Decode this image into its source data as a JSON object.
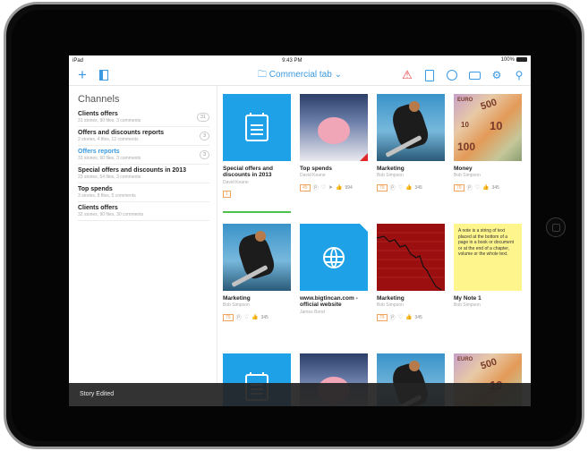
{
  "status": {
    "device": "iPad",
    "time": "9:43 PM",
    "battery": "100%"
  },
  "toolbar": {
    "title": "Commercial tab"
  },
  "channels": {
    "title": "Channels",
    "items": [
      {
        "name": "Clients offers",
        "meta": "31 stories, 90 files, 3 comments",
        "badge": "31",
        "active": false
      },
      {
        "name": "Offers and discounts reports",
        "meta": "2 stories, 4 files, 12 comments",
        "badge": "3",
        "active": false
      },
      {
        "name": "Offers reports",
        "meta": "31 stories, 90 files, 3 comments",
        "badge": "3",
        "active": true
      },
      {
        "name": "Special offers and discounts in 2013",
        "meta": "23 stories, 54 files, 3 comments",
        "badge": "",
        "active": false
      },
      {
        "name": "Top spends",
        "meta": "3 stories, 8 files, 5 comments",
        "badge": "",
        "active": false
      },
      {
        "name": "Clients offers",
        "meta": "32 stories, 90 files, 30 comments",
        "badge": "",
        "active": false
      }
    ]
  },
  "tiles": [
    {
      "title": "Special offers and discounts in 2013",
      "author": "David Keane",
      "count": "1",
      "likes": ""
    },
    {
      "title": "Top spends",
      "author": "David Keane",
      "count": "45",
      "likes": "994"
    },
    {
      "title": "Marketing",
      "author": "Bob Simpson",
      "count": "79",
      "likes": "345"
    },
    {
      "title": "Money",
      "author": "Bob Simpson",
      "count": "79",
      "likes": "345"
    },
    {
      "title": "Marketing",
      "author": "Bob Simpson",
      "count": "79",
      "likes": "345"
    },
    {
      "title": "www.bigtincan.com - official website",
      "author": "James Bond",
      "count": "",
      "likes": ""
    },
    {
      "title": "Marketing",
      "author": "Bob Simpson",
      "count": "79",
      "likes": "345"
    },
    {
      "title": "My Note 1",
      "author": "Bob Simpson",
      "count": "",
      "likes": ""
    }
  ],
  "note_text": "A note is a string of text placed at the bottom of a page in a book or document or at the end of a chapter, volume or the whole text.",
  "money_text": {
    "a": "500",
    "b": "10",
    "c": "100",
    "euro": "EURO"
  },
  "toast": "Story Edited"
}
